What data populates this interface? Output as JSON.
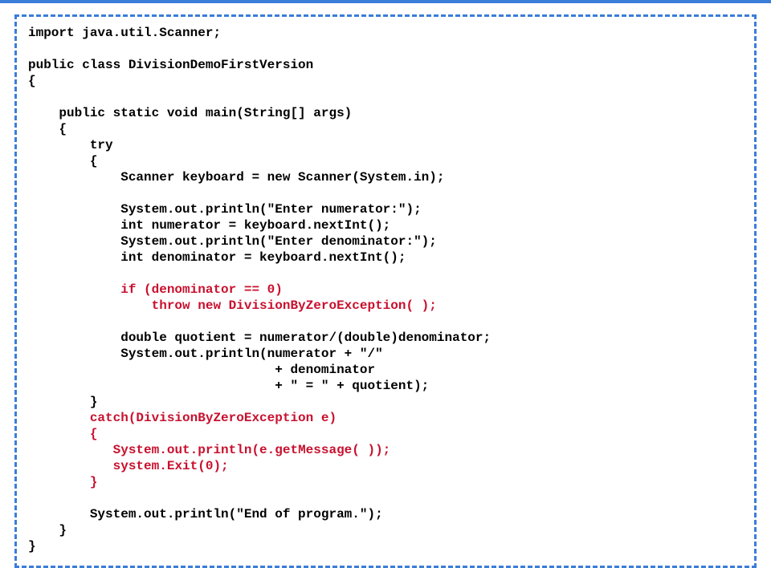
{
  "code": {
    "l1": "import java.util.Scanner;",
    "l2": "",
    "l3": "public class DivisionDemoFirstVersion",
    "l4": "{",
    "l5": "",
    "l6": "    public static void main(String[] args)",
    "l7": "    {",
    "l8": "        try",
    "l9": "        {",
    "l10": "            Scanner keyboard = new Scanner(System.in);",
    "l11": "",
    "l12": "            System.out.println(\"Enter numerator:\");",
    "l13": "            int numerator = keyboard.nextInt();",
    "l14": "            System.out.println(\"Enter denominator:\");",
    "l15": "            int denominator = keyboard.nextInt();",
    "l16": "",
    "l17a": "            ",
    "l17b": "if (denominator == 0)",
    "l18a": "                ",
    "l18b": "throw new DivisionByZeroException( );",
    "l19": "",
    "l20": "            double quotient = numerator/(double)denominator;",
    "l21": "            System.out.println(numerator + \"/\"",
    "l22": "                                + denominator",
    "l23": "                                + \" = \" + quotient);",
    "l24": "        }",
    "l25a": "        ",
    "l25b": "catch(DivisionByZeroException e)",
    "l26a": "        ",
    "l26b": "{",
    "l27a": "           ",
    "l27b": "System.out.println(e.getMessage( ));",
    "l28a": "           ",
    "l28b": "system.Exit(0);",
    "l29a": "        ",
    "l29b": "}",
    "l30": "",
    "l31": "        System.out.println(\"End of program.\");",
    "l32": "    }",
    "l33": "}"
  }
}
